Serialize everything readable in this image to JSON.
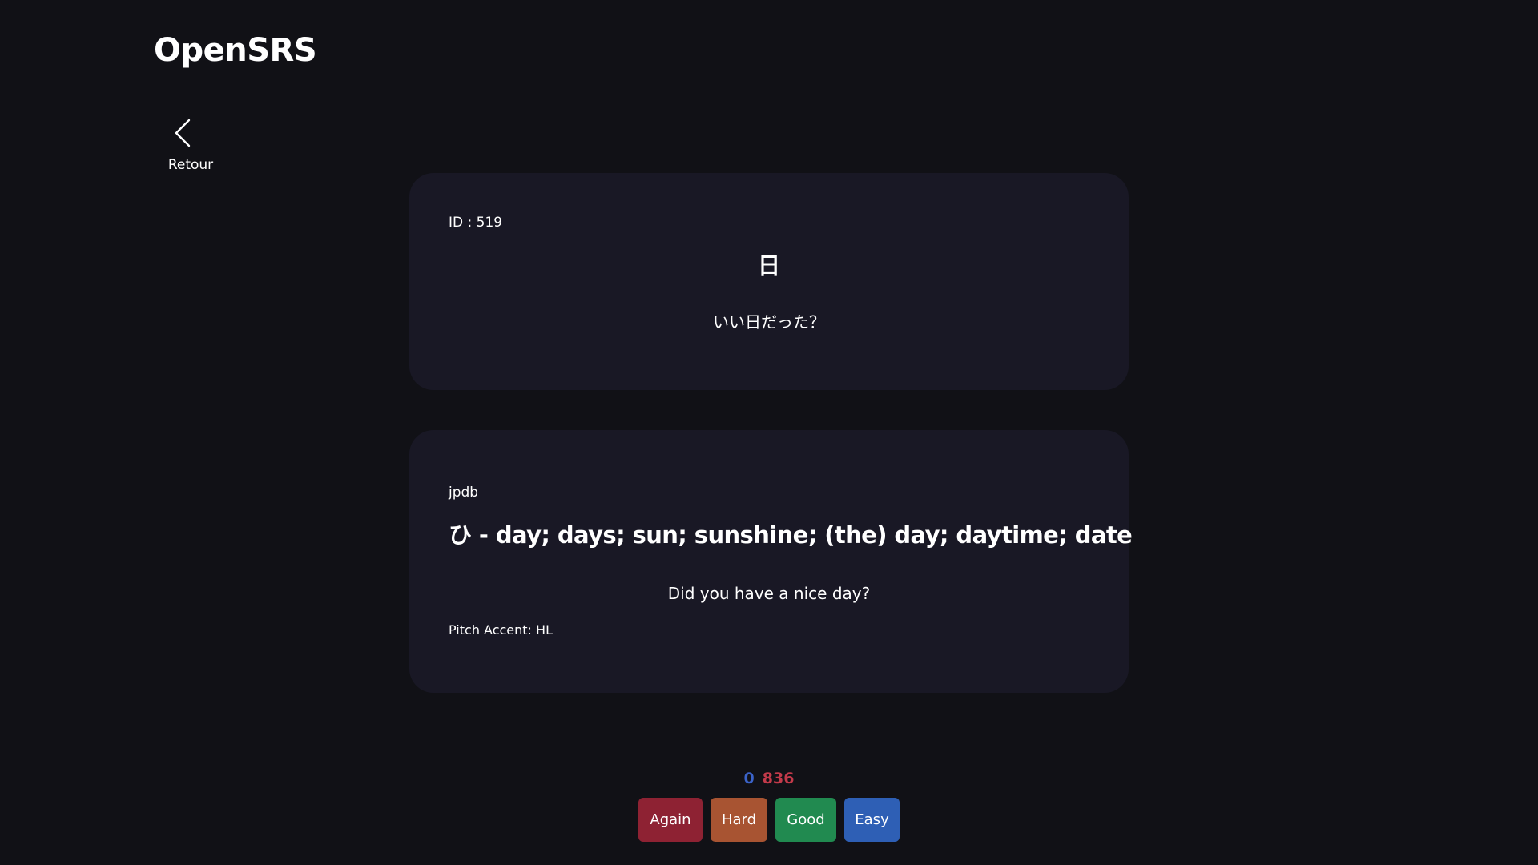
{
  "header": {
    "title": "OpenSRS"
  },
  "nav": {
    "back_label": "Retour"
  },
  "front": {
    "id_text": "ID : 519",
    "kanji": "日",
    "sentence": "いい日だった？"
  },
  "back": {
    "source": "jpdb",
    "definition": "ひ - day; days; sun; sunshine; (the) day; daytime; date",
    "translation": "Did you have a nice day?",
    "pitch_accent": "Pitch Accent: HL"
  },
  "counts": {
    "new": "0",
    "due": "836"
  },
  "answers": {
    "again": "Again",
    "hard": "Hard",
    "good": "Good",
    "easy": "Easy"
  },
  "colors": {
    "background": "#111116",
    "card": "#191825",
    "again": "#8e2233",
    "hard": "#a85432",
    "good": "#218a50",
    "easy": "#2e5fb5",
    "new_count": "#3b63c9",
    "due_count": "#c23a4a"
  }
}
